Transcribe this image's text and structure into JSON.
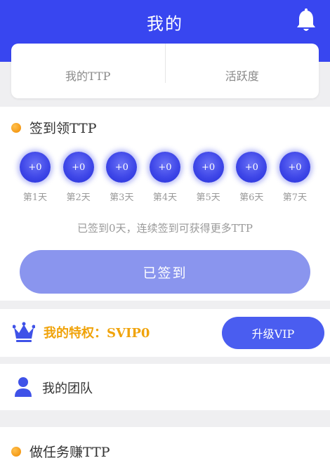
{
  "header": {
    "title": "我的"
  },
  "stats": [
    {
      "label": "我的TTP"
    },
    {
      "label": "活跃度"
    }
  ],
  "signin": {
    "title": "签到领TTP",
    "days": [
      {
        "reward": "+0",
        "label": "第1天"
      },
      {
        "reward": "+0",
        "label": "第2天"
      },
      {
        "reward": "+0",
        "label": "第3天"
      },
      {
        "reward": "+0",
        "label": "第4天"
      },
      {
        "reward": "+0",
        "label": "第5天"
      },
      {
        "reward": "+0",
        "label": "第6天"
      },
      {
        "reward": "+0",
        "label": "第7天"
      }
    ],
    "hint": "已签到0天，连续签到可获得更多TTP",
    "button": "已签到"
  },
  "vip": {
    "text": "我的特权：SVIP0",
    "button": "升级VIP"
  },
  "team": {
    "label": "我的团队"
  },
  "tasks": {
    "title": "做任务赚TTP"
  },
  "colors": {
    "header": "#3846f0",
    "accent": "#f0a30a",
    "button": "#4a5df0",
    "signed_button": "#8a95ee"
  },
  "icons": {
    "bell": "bell-icon",
    "crown": "crown-icon",
    "team": "person-icon",
    "bullet": "orange-dot-icon"
  }
}
